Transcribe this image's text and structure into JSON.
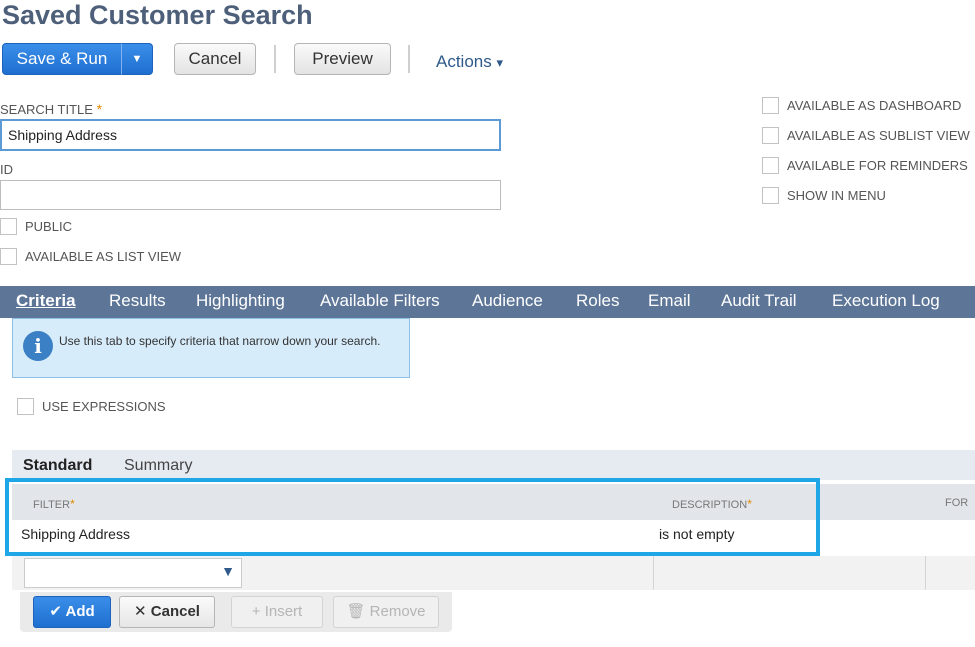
{
  "page": {
    "title": "Saved Customer Search"
  },
  "toolbar": {
    "save_run_label": "Save & Run",
    "split_arrow": "▼",
    "cancel_label": "Cancel",
    "preview_label": "Preview",
    "actions_label": "Actions",
    "actions_caret": "▾"
  },
  "form": {
    "search_title_label": "SEARCH TITLE",
    "required_mark": "*",
    "search_title_value": "Shipping Address",
    "id_label": "ID",
    "id_value": "",
    "public_label": "PUBLIC",
    "available_list_view_label": "AVAILABLE AS LIST VIEW",
    "right_options": [
      {
        "label": "AVAILABLE AS DASHBOARD"
      },
      {
        "label": "AVAILABLE AS SUBLIST VIEW"
      },
      {
        "label": "AVAILABLE FOR REMINDERS"
      },
      {
        "label": "SHOW IN MENU"
      }
    ]
  },
  "tabs": [
    {
      "label": "Criteria",
      "active": true
    },
    {
      "label": "Results"
    },
    {
      "label": "Highlighting"
    },
    {
      "label": "Available Filters"
    },
    {
      "label": "Audience"
    },
    {
      "label": "Roles"
    },
    {
      "label": "Email"
    },
    {
      "label": "Audit Trail"
    },
    {
      "label": "Execution Log"
    }
  ],
  "info": {
    "icon": "info-icon",
    "text": "Use this tab to specify criteria that narrow down your search."
  },
  "use_expressions_label": "USE EXPRESSIONS",
  "subtabs": [
    {
      "label": "Standard",
      "active": true
    },
    {
      "label": "Summary"
    }
  ],
  "grid": {
    "headers": {
      "filter": "FILTER",
      "description": "DESCRIPTION",
      "formula": "FOR"
    },
    "rows": [
      {
        "filter": "Shipping Address",
        "description": "is not empty"
      }
    ]
  },
  "row_buttons": {
    "add": "Add",
    "cancel": "Cancel",
    "insert": "Insert",
    "remove": "Remove"
  },
  "colors": {
    "title": "#4d5f79",
    "primary": "#1f6fd1",
    "tabbar": "#5d7597",
    "highlight": "#1ea6e6",
    "required": "#e08a00"
  }
}
